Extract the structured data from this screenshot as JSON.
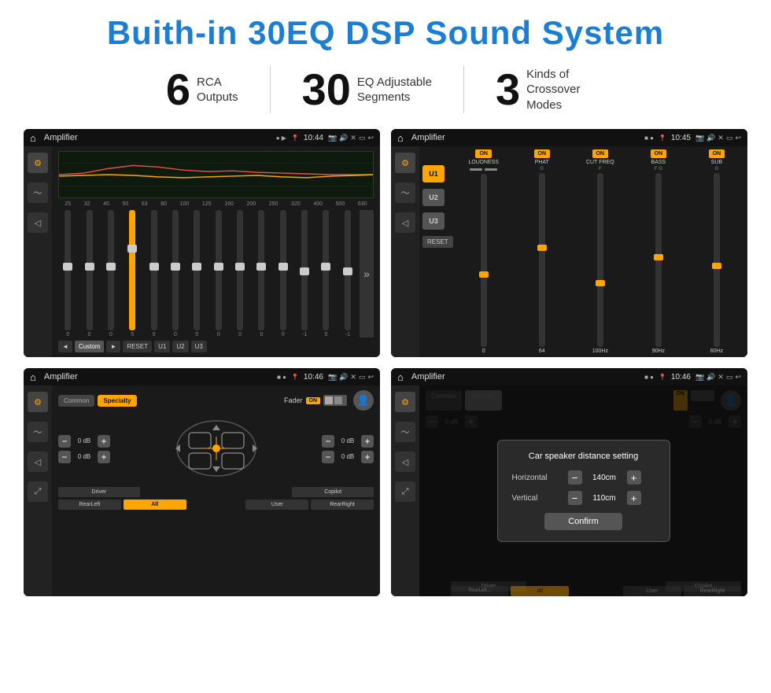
{
  "title": "Buith-in 30EQ DSP Sound System",
  "stats": [
    {
      "number": "6",
      "label": "RCA\nOutputs"
    },
    {
      "number": "30",
      "label": "EQ Adjustable\nSegments"
    },
    {
      "number": "3",
      "label": "Kinds of\nCrossover Modes"
    }
  ],
  "screens": [
    {
      "id": "eq-screen",
      "status_title": "Amplifier",
      "time": "10:44",
      "type": "eq"
    },
    {
      "id": "crossover-screen",
      "status_title": "Amplifier",
      "time": "10:45",
      "type": "crossover"
    },
    {
      "id": "fader-screen",
      "status_title": "Amplifier",
      "time": "10:46",
      "type": "fader"
    },
    {
      "id": "distance-screen",
      "status_title": "Amplifier",
      "time": "10:46",
      "type": "distance"
    }
  ],
  "eq": {
    "frequencies": [
      "25",
      "32",
      "40",
      "50",
      "63",
      "80",
      "100",
      "125",
      "160",
      "200",
      "250",
      "320",
      "400",
      "500",
      "630"
    ],
    "values": [
      "0",
      "0",
      "0",
      "5",
      "0",
      "0",
      "0",
      "0",
      "0",
      "0",
      "0",
      "-1",
      "0",
      "-1"
    ],
    "bottom_btns": [
      "◄",
      "Custom",
      "►",
      "RESET",
      "U1",
      "U2",
      "U3"
    ]
  },
  "crossover": {
    "u_buttons": [
      "U1",
      "U2",
      "U3"
    ],
    "controls": [
      "LOUDNESS",
      "PHAT",
      "CUT FREQ",
      "BASS",
      "SUB"
    ],
    "reset_label": "RESET"
  },
  "fader": {
    "tabs": [
      "Common",
      "Specialty"
    ],
    "fader_label": "Fader",
    "on_label": "ON",
    "db_values": [
      "0 dB",
      "0 dB",
      "0 dB",
      "0 dB"
    ],
    "bottom_btns": [
      "Driver",
      "",
      "",
      "",
      "Copilot",
      "RearLeft",
      "All",
      "User",
      "RearRight"
    ]
  },
  "distance": {
    "tabs": [
      "Common",
      "Specialty"
    ],
    "on_label": "ON",
    "dialog": {
      "title": "Car speaker distance setting",
      "horizontal_label": "Horizontal",
      "horizontal_value": "140cm",
      "vertical_label": "Vertical",
      "vertical_value": "110cm",
      "confirm_label": "Confirm"
    },
    "db_values": [
      "0 dB",
      "0 dB"
    ],
    "bottom_btns": [
      "Driver",
      "",
      "Copilot",
      "RearLeft...",
      "User",
      "RearRight"
    ]
  }
}
